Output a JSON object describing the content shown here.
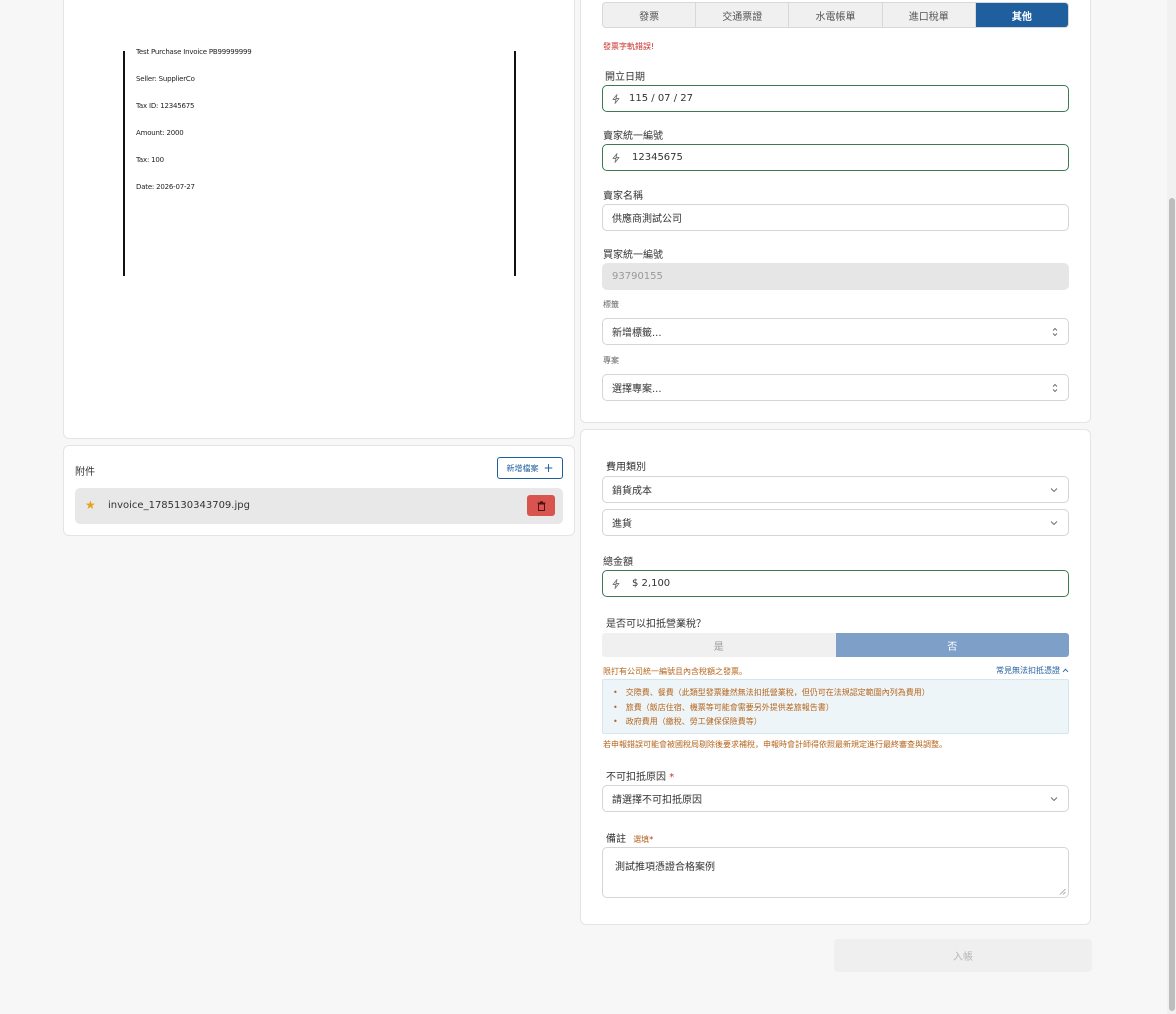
{
  "preview": {
    "lines": [
      "Test Purchase Invoice PB99999999",
      "Seller: SupplierCo",
      "Tax ID: 12345675",
      "Amount: 2000",
      "Tax: 100",
      "Date: 2026-07-27"
    ]
  },
  "attachments": {
    "title": "附件",
    "add_button": "新增檔案",
    "files": [
      {
        "name": "invoice_1785130343709.jpg"
      }
    ]
  },
  "doc_type_tabs": {
    "items": [
      "發票",
      "交通票證",
      "水電帳單",
      "進口稅單",
      "其他"
    ],
    "active": "其他"
  },
  "form": {
    "error_text": "發票字軌錯誤!",
    "issue_date_label": "開立日期",
    "issue_date_value": "115 / 07 / 27",
    "seller_tax_id_label": "賣家統一編號",
    "seller_tax_id_value": "12345675",
    "seller_name_label": "賣家名稱",
    "seller_name_value": "供應商測試公司",
    "buyer_tax_id_label": "買家統一編號",
    "buyer_tax_id_value": "93790155",
    "tags_label": "標籤",
    "tags_placeholder": "新增標籤...",
    "project_label": "專案",
    "project_placeholder": "選擇專案..."
  },
  "expense": {
    "category_label": "費用類別",
    "category_value": "銷貨成本",
    "subcategory_value": "進貨",
    "total_label": "總金額",
    "total_value": "$ 2,100",
    "deductible_label": "是否可以扣抵營業稅？",
    "yes_label": "是",
    "no_label": "否",
    "selected": "否",
    "limit_note": "限打有公司統一編號且內含稅額之發票。",
    "faq_link": "常見無法扣抵憑證",
    "faq_items": [
      "交際費、餐費（此類型發票雖然無法扣抵營業稅，但仍可在法規認定範圍內列為費用）",
      "旅費（飯店住宿、機票等可能會需要另外提供差旅報告書）",
      "政府費用（繳稅、勞工健保保險費等）"
    ],
    "warning_note": "若申報錯誤可能會被國稅局剔除後要求補稅，申報時會計師得依照最新規定進行最終審查與調整。",
    "reason_label": "不可扣抵原因",
    "reason_required": "*",
    "reason_placeholder": "請選擇不可扣抵原因",
    "memo_label": "備註",
    "memo_hint": "選填",
    "memo_required": "*",
    "memo_value": "測試推項憑證合格案例",
    "submit_label": "入帳"
  },
  "colors": {
    "primary": "#1f5f9e",
    "ai_border": "#3d7a52",
    "error": "#c9302c",
    "note": "#b5651d",
    "toggle_selected": "#7d9fc8",
    "delete": "#d9534f"
  }
}
